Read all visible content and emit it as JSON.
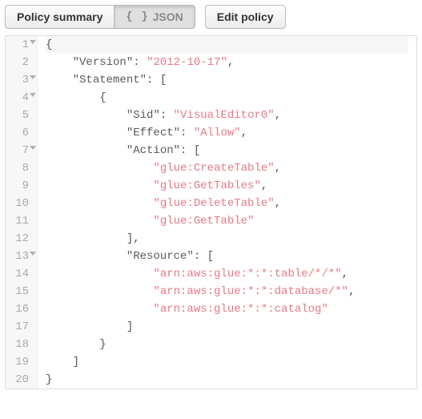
{
  "tabs": {
    "summary_label": "Policy summary",
    "json_label": "JSON",
    "edit_label": "Edit policy"
  },
  "editor": {
    "active_line": 1,
    "fold_lines": [
      1,
      3,
      4,
      7,
      13
    ],
    "lines": [
      {
        "num": 1,
        "tokens": [
          {
            "t": "punct",
            "v": "{"
          }
        ]
      },
      {
        "num": 2,
        "indent": 1,
        "tokens": [
          {
            "t": "key",
            "v": "\"Version\""
          },
          {
            "t": "punct",
            "v": ": "
          },
          {
            "t": "str",
            "v": "\"2012-10-17\""
          },
          {
            "t": "punct",
            "v": ","
          }
        ]
      },
      {
        "num": 3,
        "indent": 1,
        "tokens": [
          {
            "t": "key",
            "v": "\"Statement\""
          },
          {
            "t": "punct",
            "v": ": ["
          }
        ]
      },
      {
        "num": 4,
        "indent": 2,
        "tokens": [
          {
            "t": "punct",
            "v": "{"
          }
        ]
      },
      {
        "num": 5,
        "indent": 3,
        "tokens": [
          {
            "t": "key",
            "v": "\"Sid\""
          },
          {
            "t": "punct",
            "v": ": "
          },
          {
            "t": "str",
            "v": "\"VisualEditor0\""
          },
          {
            "t": "punct",
            "v": ","
          }
        ]
      },
      {
        "num": 6,
        "indent": 3,
        "tokens": [
          {
            "t": "key",
            "v": "\"Effect\""
          },
          {
            "t": "punct",
            "v": ": "
          },
          {
            "t": "str",
            "v": "\"Allow\""
          },
          {
            "t": "punct",
            "v": ","
          }
        ]
      },
      {
        "num": 7,
        "indent": 3,
        "tokens": [
          {
            "t": "key",
            "v": "\"Action\""
          },
          {
            "t": "punct",
            "v": ": ["
          }
        ]
      },
      {
        "num": 8,
        "indent": 4,
        "tokens": [
          {
            "t": "str",
            "v": "\"glue:CreateTable\""
          },
          {
            "t": "punct",
            "v": ","
          }
        ]
      },
      {
        "num": 9,
        "indent": 4,
        "tokens": [
          {
            "t": "str",
            "v": "\"glue:GetTables\""
          },
          {
            "t": "punct",
            "v": ","
          }
        ]
      },
      {
        "num": 10,
        "indent": 4,
        "tokens": [
          {
            "t": "str",
            "v": "\"glue:DeleteTable\""
          },
          {
            "t": "punct",
            "v": ","
          }
        ]
      },
      {
        "num": 11,
        "indent": 4,
        "tokens": [
          {
            "t": "str",
            "v": "\"glue:GetTable\""
          }
        ]
      },
      {
        "num": 12,
        "indent": 3,
        "tokens": [
          {
            "t": "punct",
            "v": "],"
          }
        ]
      },
      {
        "num": 13,
        "indent": 3,
        "tokens": [
          {
            "t": "key",
            "v": "\"Resource\""
          },
          {
            "t": "punct",
            "v": ": ["
          }
        ]
      },
      {
        "num": 14,
        "indent": 4,
        "tokens": [
          {
            "t": "str",
            "v": "\"arn:aws:glue:*:*:table/*/*\""
          },
          {
            "t": "punct",
            "v": ","
          }
        ]
      },
      {
        "num": 15,
        "indent": 4,
        "tokens": [
          {
            "t": "str",
            "v": "\"arn:aws:glue:*:*:database/*\""
          },
          {
            "t": "punct",
            "v": ","
          }
        ]
      },
      {
        "num": 16,
        "indent": 4,
        "tokens": [
          {
            "t": "str",
            "v": "\"arn:aws:glue:*:*:catalog\""
          }
        ]
      },
      {
        "num": 17,
        "indent": 3,
        "tokens": [
          {
            "t": "punct",
            "v": "]"
          }
        ]
      },
      {
        "num": 18,
        "indent": 2,
        "tokens": [
          {
            "t": "punct",
            "v": "}"
          }
        ]
      },
      {
        "num": 19,
        "indent": 1,
        "tokens": [
          {
            "t": "punct",
            "v": "]"
          }
        ]
      },
      {
        "num": 20,
        "tokens": [
          {
            "t": "punct",
            "v": "}"
          }
        ]
      }
    ]
  }
}
